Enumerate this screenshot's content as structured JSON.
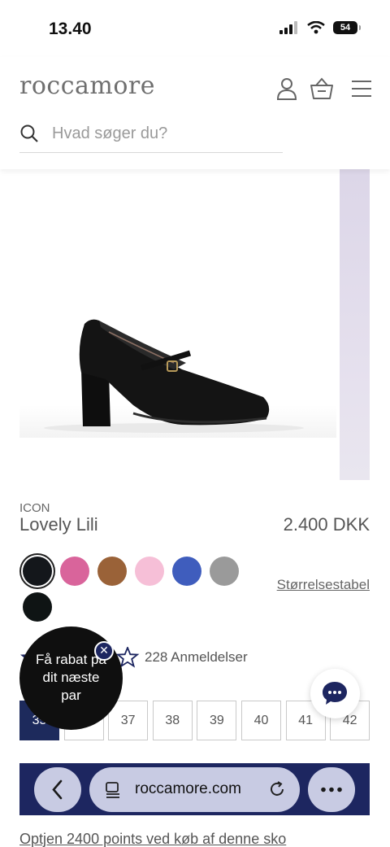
{
  "status_bar": {
    "time": "13.40",
    "battery": "54"
  },
  "header": {
    "logo": "roccamore",
    "search_placeholder": "Hvad søger du?",
    "icons": [
      "account-icon",
      "basket-icon",
      "menu-icon"
    ]
  },
  "product": {
    "brand": "ICON",
    "name": "Lovely Lili",
    "price": "2.400 DKK",
    "size_guide": "Størrelsestabel",
    "swatches": [
      "#14171b",
      "#d9649b",
      "#9a6238",
      "#f6bfd7",
      "#3f5dbd",
      "#9a9a9a",
      "#0f1414"
    ],
    "selected_swatch": 0,
    "rating": 4,
    "reviews": "228 Anmeldelser",
    "sizes": [
      "35",
      "36",
      "37",
      "38",
      "39",
      "40",
      "41",
      "42"
    ],
    "selected_size": "35",
    "loyalty": "Optjen 2400 points ved køb af denne sko"
  },
  "promo": {
    "line1": "Få rabat på",
    "line2": "dit næste",
    "line3": "par"
  },
  "browser": {
    "url": "roccamore.com"
  },
  "colors": {
    "navy": "#1d2a5c",
    "text": "#555555",
    "peek": "#dcd6e8"
  }
}
